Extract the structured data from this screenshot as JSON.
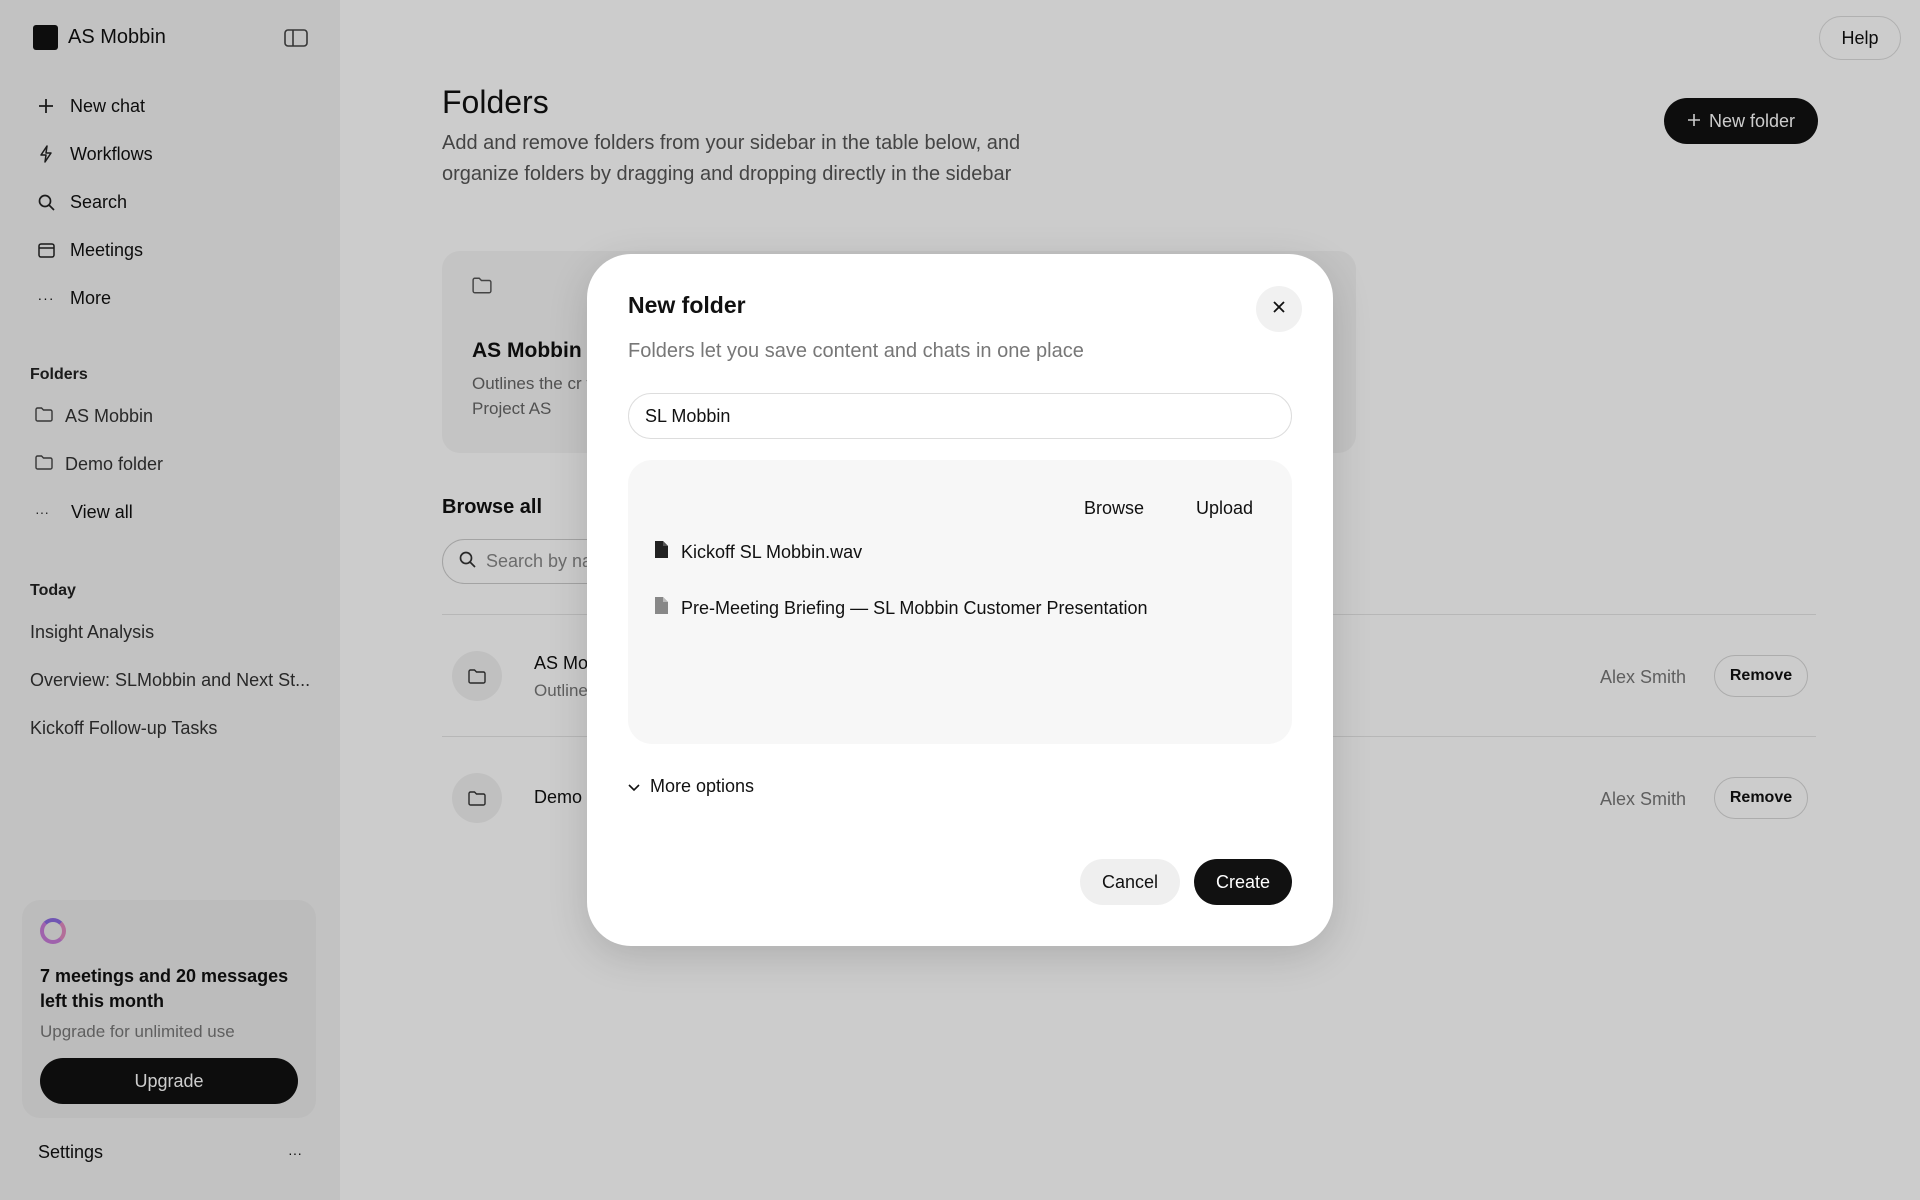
{
  "sidebar": {
    "brand": "AS Mobbin",
    "nav": [
      {
        "label": "New chat",
        "icon": "plus-icon"
      },
      {
        "label": "Workflows",
        "icon": "bolt-icon"
      },
      {
        "label": "Search",
        "icon": "search-icon"
      },
      {
        "label": "Meetings",
        "icon": "calendar-icon"
      },
      {
        "label": "More",
        "icon": "ellipsis-icon"
      }
    ],
    "folders_title": "Folders",
    "folders": [
      {
        "label": "AS Mobbin"
      },
      {
        "label": "Demo folder"
      },
      {
        "label": "View all"
      }
    ],
    "today_title": "Today",
    "today": [
      {
        "label": "Insight Analysis"
      },
      {
        "label": "Overview: SLMobbin and Next St..."
      },
      {
        "label": "Kickoff Follow-up Tasks"
      }
    ],
    "usage": {
      "title": "7 meetings and 20 messages left this month",
      "subtitle": "Upgrade for unlimited use",
      "button": "Upgrade"
    },
    "settings": "Settings"
  },
  "header": {
    "help": "Help"
  },
  "main": {
    "title": "Folders",
    "description": "Add and remove folders from your sidebar in the table below, and organize folders by dragging and dropping directly in the sidebar",
    "new_folder": "New folder",
    "card": {
      "title": "AS Mobbin",
      "description": "Outlines the cr the Project AS"
    },
    "browse_all": "Browse all",
    "search_placeholder": "Search by na",
    "rows": [
      {
        "title": "AS Mo",
        "subtitle": "Outline",
        "owner": "Alex Smith",
        "action": "Remove"
      },
      {
        "title": "Demo",
        "subtitle": "",
        "owner": "Alex Smith",
        "action": "Remove"
      }
    ]
  },
  "modal": {
    "title": "New folder",
    "subtitle": "Folders let you save content and chats in one place",
    "input_value": "SL Mobbin",
    "browse": "Browse",
    "upload": "Upload",
    "files": [
      {
        "name": "Kickoff SL Mobbin.wav",
        "icon": "file-icon"
      },
      {
        "name": "Pre-Meeting Briefing — SL Mobbin Customer Presentation",
        "icon": "file-icon"
      }
    ],
    "more_options": "More options",
    "cancel": "Cancel",
    "create": "Create"
  },
  "colors": {
    "primary": "#111111",
    "overlay": "rgba(0,0,0,0.2)",
    "sidebar_bg": "#f3f3f3"
  }
}
